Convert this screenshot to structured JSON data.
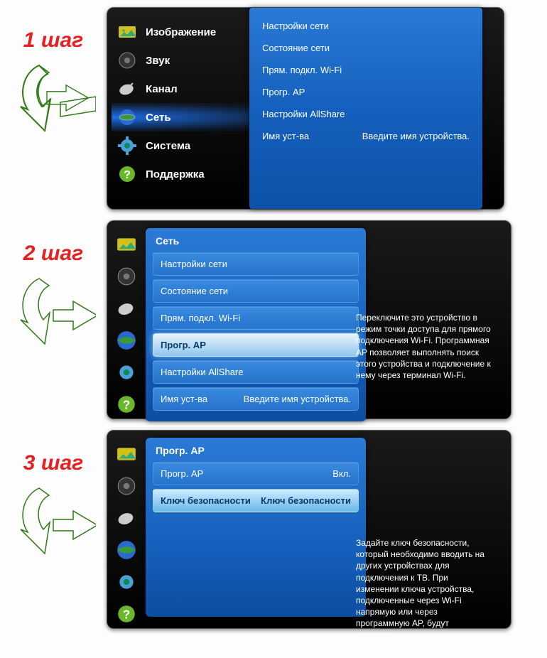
{
  "steps": {
    "s1_label": "1 шаг",
    "s2_label": "2 шаг",
    "s3_label": "3 шаг"
  },
  "step1": {
    "menu": [
      {
        "label": "Изображение",
        "icon": "picture"
      },
      {
        "label": "Звук",
        "icon": "speaker"
      },
      {
        "label": "Канал",
        "icon": "dish"
      },
      {
        "label": "Сеть",
        "icon": "globe",
        "selected": true
      },
      {
        "label": "Система",
        "icon": "gear"
      },
      {
        "label": "Поддержка",
        "icon": "question"
      }
    ],
    "submenu": [
      "Настройки сети",
      "Состояние сети",
      "Прям. подкл. Wi-Fi",
      "Прогр. AP",
      "Настройки AllShare"
    ],
    "device_label": "Имя уст-ва",
    "device_hint": "Введите имя устройства."
  },
  "step2": {
    "panel_title": "Сеть",
    "rows": [
      {
        "label": "Настройки сети"
      },
      {
        "label": "Состояние сети"
      },
      {
        "label": "Прям. подкл. Wi-Fi"
      },
      {
        "label": "Прогр. AP",
        "selected": true
      },
      {
        "label": "Настройки AllShare"
      },
      {
        "label": "Имя уст-ва",
        "value": "Введите имя устройства."
      }
    ],
    "help": "Переключите это устройство в режим точки доступа для прямого подключения Wi-Fi. Программная AP позволяет выполнять поиск этого устройства и подключение к нему через терминал Wi-Fi."
  },
  "step3": {
    "panel_title": "Прогр. AP",
    "rows": [
      {
        "label": "Прогр. AP",
        "value": "Вкл."
      },
      {
        "label": "Ключ безопасности",
        "value": "Ключ безопасности",
        "selected": true
      }
    ],
    "help": "Задайте ключ безопасности, который необходимо вводить на других устройствах для подключения к ТВ. При изменении ключа устройства, подключенные через Wi-Fi напрямую или через программную AP, будут отключены."
  }
}
